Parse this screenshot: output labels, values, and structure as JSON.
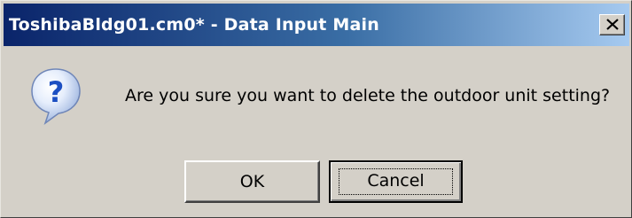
{
  "window": {
    "title": "ToshibaBldg01.cm0* - Data Input Main"
  },
  "dialog": {
    "icon": "question-icon",
    "message": "Are you sure you want to delete the outdoor unit setting?"
  },
  "buttons": {
    "ok_label": "OK",
    "cancel_label": "Cancel"
  },
  "colors": {
    "titlebar_start": "#0a246a",
    "titlebar_end": "#a6caf0",
    "dialog_background": "#d4d0c8",
    "icon_blue": "#3a6fd0"
  }
}
